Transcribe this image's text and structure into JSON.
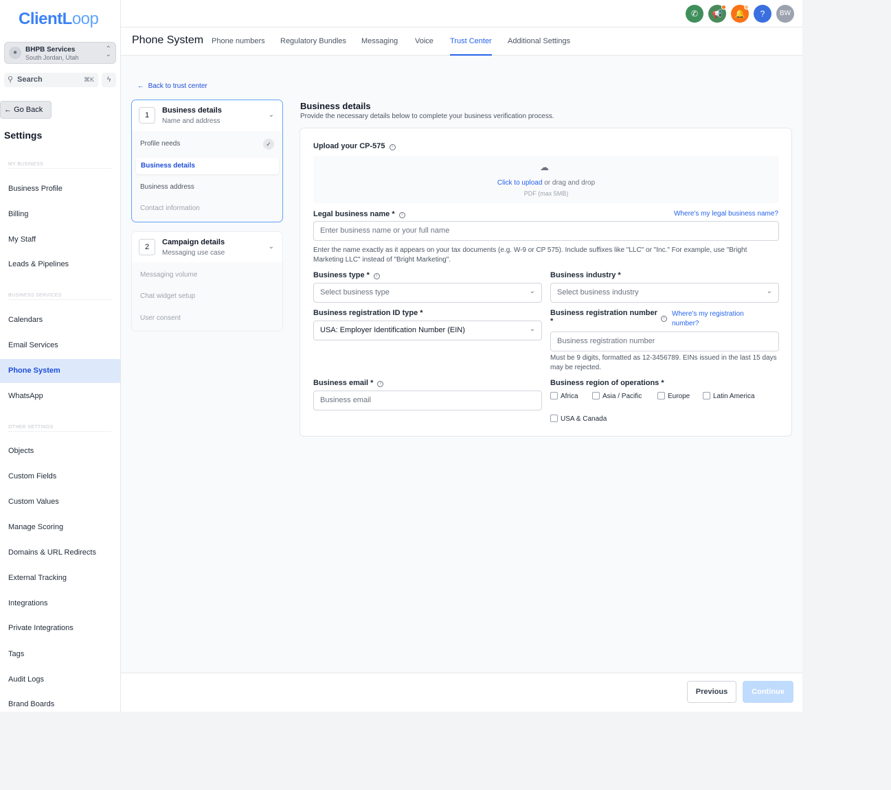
{
  "sidebar": {
    "logo_main": "ClientL",
    "logo_tail": "oop",
    "account": {
      "name": "BHPB Services",
      "location": "South Jordan, Utah",
      "avatar_icon": "person-icon"
    },
    "search": {
      "label": "Search",
      "shortcut": "⌘K"
    },
    "go_back": "Go Back",
    "settings_title": "Settings",
    "section_my_business": "MY BUSINESS",
    "section_business_services": "BUSINESS SERVICES",
    "section_other_settings": "OTHER SETTINGS",
    "items": [
      {
        "label": "Business Profile"
      },
      {
        "label": "Billing"
      },
      {
        "label": "My Staff"
      },
      {
        "label": "Leads & Pipelines"
      },
      {
        "label": "Calendars"
      },
      {
        "label": "Email Services"
      },
      {
        "label": "Phone System"
      },
      {
        "label": "WhatsApp"
      },
      {
        "label": "Objects"
      },
      {
        "label": "Custom Fields"
      },
      {
        "label": "Custom Values"
      },
      {
        "label": "Manage Scoring"
      },
      {
        "label": "Domains & URL Redirects"
      },
      {
        "label": "External Tracking"
      },
      {
        "label": "Integrations"
      },
      {
        "label": "Private Integrations"
      },
      {
        "label": "Tags"
      },
      {
        "label": "Audit Logs"
      },
      {
        "label": "Brand Boards"
      }
    ],
    "active_item": "Phone System"
  },
  "topbar": {
    "buttons": [
      {
        "icon": "phone-icon",
        "color": "#3f8f5b"
      },
      {
        "icon": "megaphone-icon",
        "color": "#4a8a5a"
      },
      {
        "icon": "bell-icon",
        "color": "#f97316"
      },
      {
        "icon": "help-icon",
        "color": "#3b6fe0"
      }
    ],
    "avatar_initials": "BW"
  },
  "subnav": {
    "title": "Phone System",
    "tabs": [
      "Phone numbers",
      "Regulatory Bundles",
      "Messaging",
      "Voice",
      "Trust Center",
      "Additional Settings"
    ],
    "active_tab": "Trust Center"
  },
  "back_link": "Back to trust center",
  "steps": [
    {
      "number": "1",
      "title": "Business details",
      "subtitle": "Name and address",
      "items": [
        "Profile needs",
        "Business details",
        "Business address",
        "Contact information"
      ],
      "active_item": "Business details",
      "completed_item": "Profile needs"
    },
    {
      "number": "2",
      "title": "Campaign details",
      "subtitle": "Messaging use case",
      "items": [
        "Messaging volume",
        "Chat widget setup",
        "User consent"
      ]
    }
  ],
  "form": {
    "title": "Business details",
    "subtitle": "Provide the necessary details below to complete your business verification process.",
    "upload_label": "Upload your CP-575",
    "upload_link": "Click to upload",
    "upload_text": " or drag and drop",
    "upload_hint": "PDF (max 5MB)",
    "legal_name_label": "Legal business name *",
    "legal_name_link": "Where's my legal business name?",
    "legal_name_placeholder": "Enter business name or your full name",
    "legal_name_help": "Enter the name exactly as it appears on your tax documents (e.g. W-9 or CP 575). Include suffixes like \"LLC\" or \"Inc.\" For example, use \"Bright Marketing LLC\" instead of \"Bright Marketing\".",
    "business_type_label": "Business type *",
    "business_type_placeholder": "Select business type",
    "industry_label": "Business industry *",
    "industry_placeholder": "Select business industry",
    "reg_id_type_label": "Business registration ID type *",
    "reg_id_type_value": "USA: Employer Identification Number (EIN)",
    "reg_number_label": "Business registration number",
    "reg_number_star": "*",
    "reg_number_link": "Where's my registration number?",
    "reg_number_placeholder": "Business registration number",
    "reg_number_help": "Must be 9 digits, formatted as 12-3456789. EINs issued in the last 15 days may be rejected.",
    "email_label": "Business email *",
    "email_placeholder": "Business email",
    "regions_label": "Business region of operations *",
    "regions": [
      "Africa",
      "Asia / Pacific",
      "Europe",
      "Latin America",
      "USA & Canada"
    ]
  },
  "footer": {
    "previous": "Previous",
    "continue": "Continue"
  }
}
